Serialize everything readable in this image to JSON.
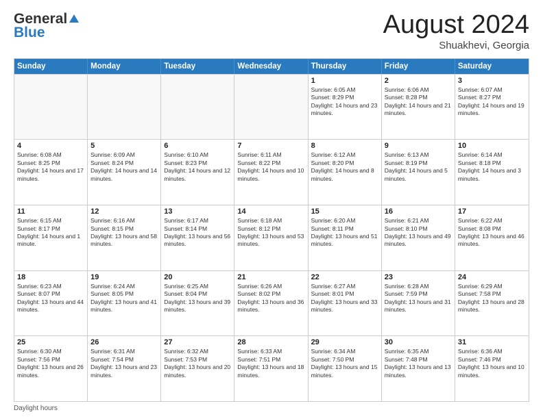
{
  "logo": {
    "general": "General",
    "blue": "Blue"
  },
  "title": {
    "month_year": "August 2024",
    "location": "Shuakhevi, Georgia"
  },
  "days_of_week": [
    "Sunday",
    "Monday",
    "Tuesday",
    "Wednesday",
    "Thursday",
    "Friday",
    "Saturday"
  ],
  "weeks": [
    [
      {
        "day": "",
        "content": ""
      },
      {
        "day": "",
        "content": ""
      },
      {
        "day": "",
        "content": ""
      },
      {
        "day": "",
        "content": ""
      },
      {
        "day": "1",
        "content": "Sunrise: 6:05 AM\nSunset: 8:29 PM\nDaylight: 14 hours and 23 minutes."
      },
      {
        "day": "2",
        "content": "Sunrise: 6:06 AM\nSunset: 8:28 PM\nDaylight: 14 hours and 21 minutes."
      },
      {
        "day": "3",
        "content": "Sunrise: 6:07 AM\nSunset: 8:27 PM\nDaylight: 14 hours and 19 minutes."
      }
    ],
    [
      {
        "day": "4",
        "content": "Sunrise: 6:08 AM\nSunset: 8:25 PM\nDaylight: 14 hours and 17 minutes."
      },
      {
        "day": "5",
        "content": "Sunrise: 6:09 AM\nSunset: 8:24 PM\nDaylight: 14 hours and 14 minutes."
      },
      {
        "day": "6",
        "content": "Sunrise: 6:10 AM\nSunset: 8:23 PM\nDaylight: 14 hours and 12 minutes."
      },
      {
        "day": "7",
        "content": "Sunrise: 6:11 AM\nSunset: 8:22 PM\nDaylight: 14 hours and 10 minutes."
      },
      {
        "day": "8",
        "content": "Sunrise: 6:12 AM\nSunset: 8:20 PM\nDaylight: 14 hours and 8 minutes."
      },
      {
        "day": "9",
        "content": "Sunrise: 6:13 AM\nSunset: 8:19 PM\nDaylight: 14 hours and 5 minutes."
      },
      {
        "day": "10",
        "content": "Sunrise: 6:14 AM\nSunset: 8:18 PM\nDaylight: 14 hours and 3 minutes."
      }
    ],
    [
      {
        "day": "11",
        "content": "Sunrise: 6:15 AM\nSunset: 8:17 PM\nDaylight: 14 hours and 1 minute."
      },
      {
        "day": "12",
        "content": "Sunrise: 6:16 AM\nSunset: 8:15 PM\nDaylight: 13 hours and 58 minutes."
      },
      {
        "day": "13",
        "content": "Sunrise: 6:17 AM\nSunset: 8:14 PM\nDaylight: 13 hours and 56 minutes."
      },
      {
        "day": "14",
        "content": "Sunrise: 6:18 AM\nSunset: 8:12 PM\nDaylight: 13 hours and 53 minutes."
      },
      {
        "day": "15",
        "content": "Sunrise: 6:20 AM\nSunset: 8:11 PM\nDaylight: 13 hours and 51 minutes."
      },
      {
        "day": "16",
        "content": "Sunrise: 6:21 AM\nSunset: 8:10 PM\nDaylight: 13 hours and 49 minutes."
      },
      {
        "day": "17",
        "content": "Sunrise: 6:22 AM\nSunset: 8:08 PM\nDaylight: 13 hours and 46 minutes."
      }
    ],
    [
      {
        "day": "18",
        "content": "Sunrise: 6:23 AM\nSunset: 8:07 PM\nDaylight: 13 hours and 44 minutes."
      },
      {
        "day": "19",
        "content": "Sunrise: 6:24 AM\nSunset: 8:05 PM\nDaylight: 13 hours and 41 minutes."
      },
      {
        "day": "20",
        "content": "Sunrise: 6:25 AM\nSunset: 8:04 PM\nDaylight: 13 hours and 39 minutes."
      },
      {
        "day": "21",
        "content": "Sunrise: 6:26 AM\nSunset: 8:02 PM\nDaylight: 13 hours and 36 minutes."
      },
      {
        "day": "22",
        "content": "Sunrise: 6:27 AM\nSunset: 8:01 PM\nDaylight: 13 hours and 33 minutes."
      },
      {
        "day": "23",
        "content": "Sunrise: 6:28 AM\nSunset: 7:59 PM\nDaylight: 13 hours and 31 minutes."
      },
      {
        "day": "24",
        "content": "Sunrise: 6:29 AM\nSunset: 7:58 PM\nDaylight: 13 hours and 28 minutes."
      }
    ],
    [
      {
        "day": "25",
        "content": "Sunrise: 6:30 AM\nSunset: 7:56 PM\nDaylight: 13 hours and 26 minutes."
      },
      {
        "day": "26",
        "content": "Sunrise: 6:31 AM\nSunset: 7:54 PM\nDaylight: 13 hours and 23 minutes."
      },
      {
        "day": "27",
        "content": "Sunrise: 6:32 AM\nSunset: 7:53 PM\nDaylight: 13 hours and 20 minutes."
      },
      {
        "day": "28",
        "content": "Sunrise: 6:33 AM\nSunset: 7:51 PM\nDaylight: 13 hours and 18 minutes."
      },
      {
        "day": "29",
        "content": "Sunrise: 6:34 AM\nSunset: 7:50 PM\nDaylight: 13 hours and 15 minutes."
      },
      {
        "day": "30",
        "content": "Sunrise: 6:35 AM\nSunset: 7:48 PM\nDaylight: 13 hours and 13 minutes."
      },
      {
        "day": "31",
        "content": "Sunrise: 6:36 AM\nSunset: 7:46 PM\nDaylight: 13 hours and 10 minutes."
      }
    ]
  ],
  "footer": {
    "note": "Daylight hours"
  }
}
